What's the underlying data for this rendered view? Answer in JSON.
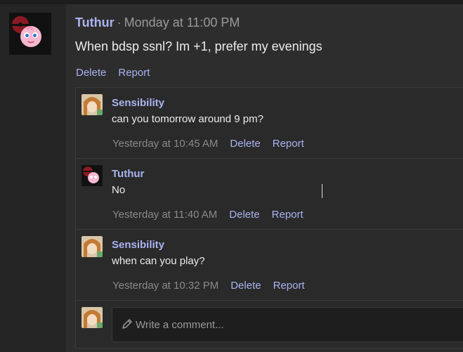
{
  "post": {
    "author": "Tuthur",
    "separator": "·",
    "timestamp": "Monday at 11:00 PM",
    "body": "When bdsp ssnl? Im +1, prefer my evenings",
    "actions": {
      "delete": "Delete",
      "report": "Report"
    }
  },
  "comments": [
    {
      "author": "Sensibility",
      "text": "can you tomorrow around 9 pm?",
      "timestamp": "Yesterday at 10:45 AM",
      "delete": "Delete",
      "report": "Report"
    },
    {
      "author": "Tuthur",
      "text": "No",
      "timestamp": "Yesterday at 11:40 AM",
      "delete": "Delete",
      "report": "Report"
    },
    {
      "author": "Sensibility",
      "text": "when can you play?",
      "timestamp": "Yesterday at 10:32 PM",
      "delete": "Delete",
      "report": "Report"
    }
  ],
  "composer": {
    "placeholder": "Write a comment..."
  },
  "colors": {
    "accent": "#a9b4f0",
    "text": "#ececec",
    "muted": "#8a8a8a",
    "background": "#2d2d2d"
  },
  "icons": {
    "composer": "pencil-icon"
  }
}
